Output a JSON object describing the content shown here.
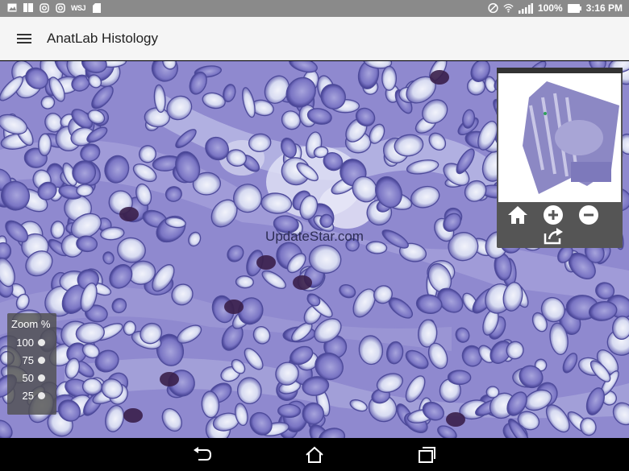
{
  "status_bar": {
    "battery": "100%",
    "time": "3:16 PM",
    "wsj_label": "WSJ",
    "icons": [
      "image-icon",
      "book-icon",
      "instagram-icon",
      "instagram-icon",
      "wsj-icon",
      "sd-card-icon",
      "dnd-icon",
      "wifi-icon",
      "signal-icon",
      "battery-icon"
    ]
  },
  "app_bar": {
    "title": "AnatLab Histology",
    "menu_icon": "hamburger-menu-icon"
  },
  "viewer": {
    "watermark": "UpdateStar.com"
  },
  "overview": {
    "buttons": [
      "home-icon",
      "zoom-in-icon",
      "zoom-out-icon",
      "share-icon"
    ]
  },
  "zoom_panel": {
    "title": "Zoom %",
    "levels": [
      "100",
      "75",
      "50",
      "25"
    ]
  },
  "nav_bar": {
    "buttons": [
      "back-icon",
      "home-icon",
      "recents-icon"
    ]
  },
  "colors": {
    "tissue_base": "#8c86cc",
    "nucleus_fill": "#dcdff2",
    "nucleus_edge": "#4d4a9a",
    "granule_dark": "#3a1f4a"
  }
}
